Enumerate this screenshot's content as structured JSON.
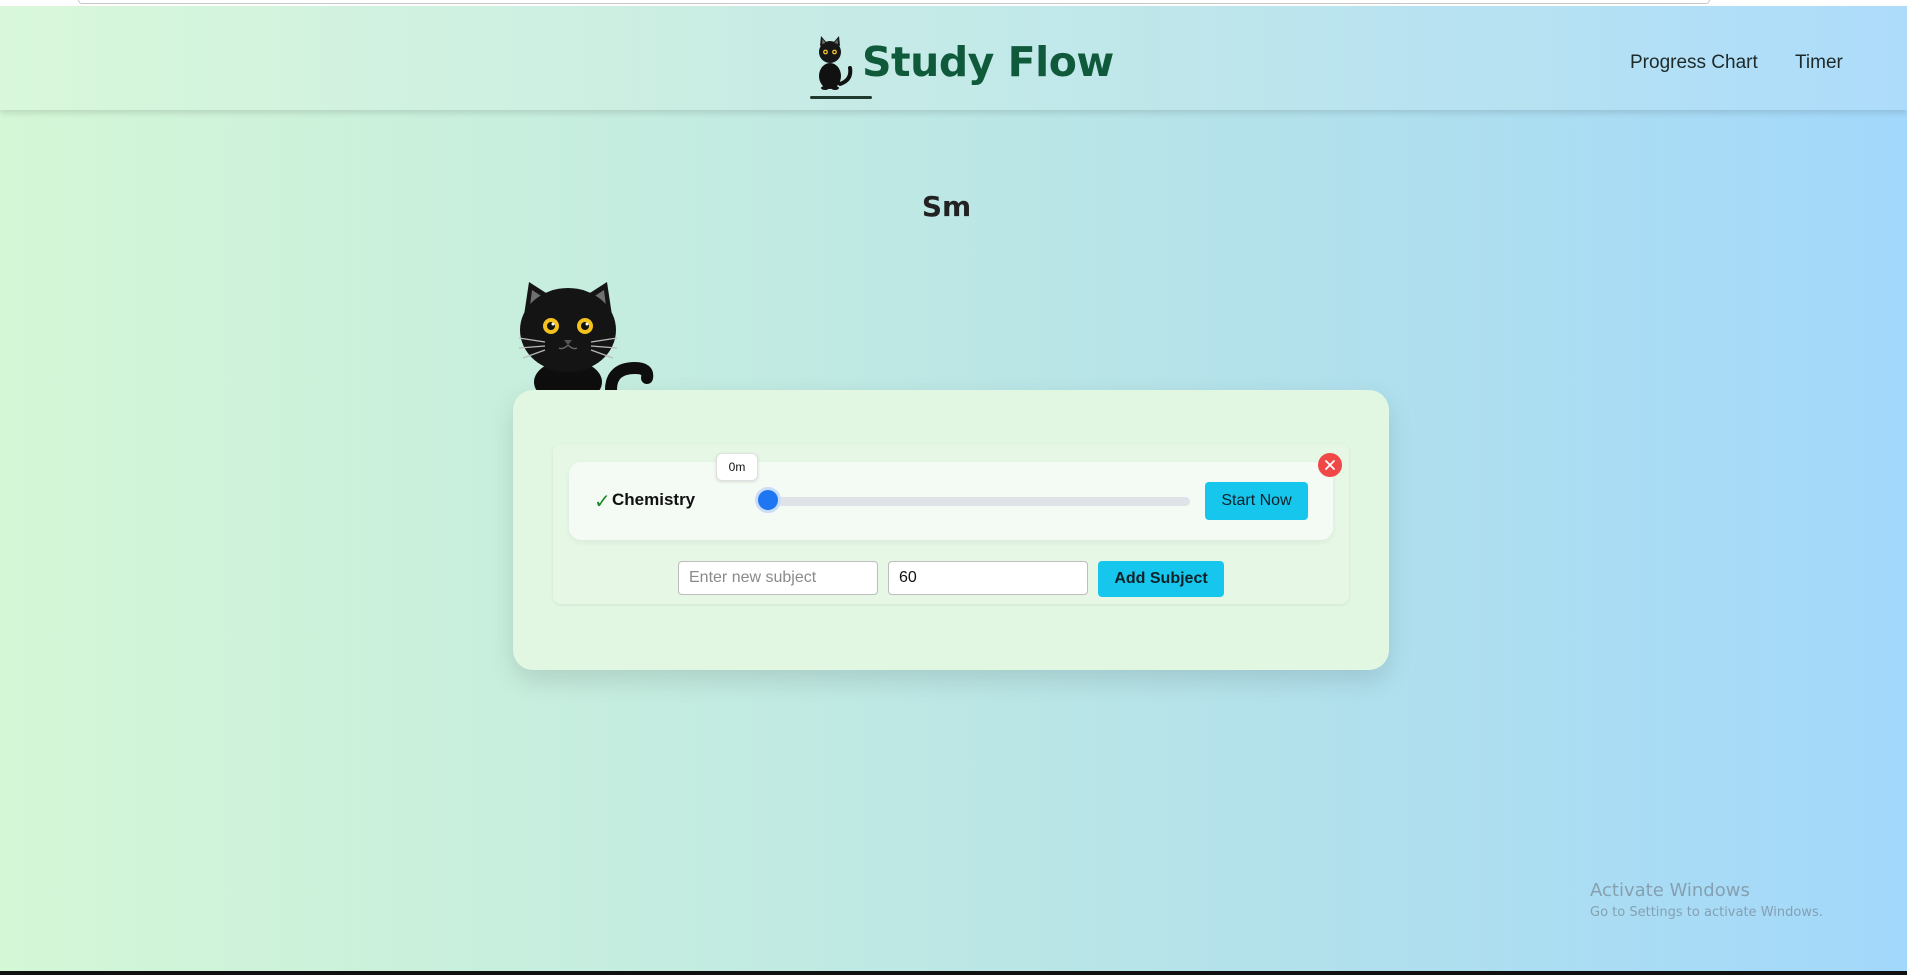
{
  "app": {
    "title": "Study Flow",
    "brand_icon": "cat-icon"
  },
  "nav": {
    "items": [
      {
        "label": "Progress Chart"
      },
      {
        "label": "Timer"
      }
    ]
  },
  "user": {
    "name": "Sm"
  },
  "subjects": [
    {
      "status_icon": "check-icon",
      "status_mark": "✓",
      "name": "Chemistry",
      "progress_label": "0m",
      "progress_fraction": 0.0,
      "start_label": "Start Now",
      "remove_icon": "close-icon"
    }
  ],
  "add_form": {
    "subject_placeholder": "Enter new subject",
    "subject_value": "",
    "minutes_value": "60",
    "add_label": "Add Subject"
  },
  "watermark": {
    "title": "Activate Windows",
    "subtitle": "Go to Settings to activate Windows."
  },
  "colors": {
    "accent": "#16c6ec",
    "brand_text": "#0f5a3a",
    "slider_thumb": "#1e76f2",
    "remove": "#f04747",
    "check": "#1e8a2a"
  }
}
